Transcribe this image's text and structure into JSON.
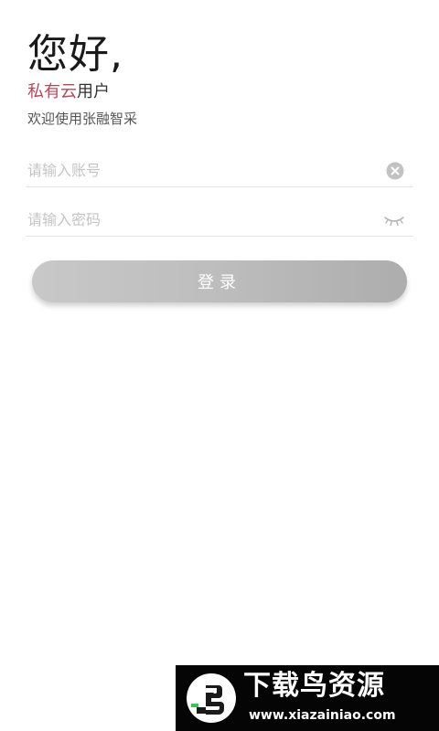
{
  "header": {
    "greeting": "您好,",
    "subtitle_brand": "私有云",
    "subtitle_rest": "用户",
    "welcome": "欢迎使用张融智采"
  },
  "form": {
    "account": {
      "placeholder": "请输入账号",
      "value": "",
      "action_icon": "clear-icon"
    },
    "password": {
      "placeholder": "请输入密码",
      "value": "",
      "action_icon": "eye-closed-icon"
    },
    "login_label": "登录"
  },
  "watermark": {
    "title": "下载鸟资源",
    "url": "www.xiazainiao.com"
  },
  "colors": {
    "brand_accent": "#b24a5b",
    "text_primary": "#1a1a1a",
    "placeholder": "#c4c4c4",
    "button_bg": "#bdbdbd",
    "button_text": "#ffffff"
  }
}
